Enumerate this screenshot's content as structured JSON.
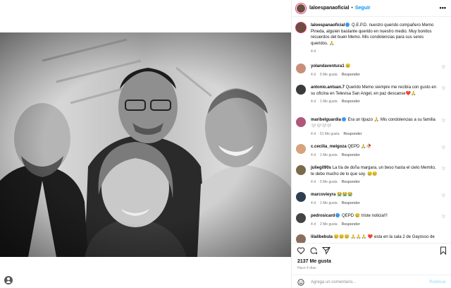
{
  "post": {
    "username": "laloespanaoficial",
    "follow_label": "Seguir",
    "more_label": "•••",
    "caption_user": "laloespanaoficial",
    "caption_text": "Q.E.P.D. nuestro querido compañero Memo Pineda, alguien bastante querido en nuestro medio. Muy bonitos recuerdos del buen Memo. Mis condolencias para sus seres queridos. 🙏",
    "caption_time": "4 d"
  },
  "comments": [
    {
      "user": "yolandaventura1",
      "text": "😢",
      "time": "4 d",
      "likes": "5 Me gusta",
      "reply": "Responder",
      "avatar_color": "#c98f7a"
    },
    {
      "user": "antonio.antuan.7",
      "text": "Querido Memo siempre me recibía con gusto en su oficina en Televisa San Angel, en paz descanse❤️🙏",
      "time": "4 d",
      "likes": "1 Me gusta",
      "reply": "Responder",
      "avatar_color": "#3b3b3b"
    },
    {
      "user": "maribelguardia",
      "text": "Era un tipazo 🙏 Mis condolencias a su familia 🤍🤍🤍🤍",
      "time": "4 d",
      "likes": "51 Me gusta",
      "reply": "Responder",
      "avatar_color": "#b0567a"
    },
    {
      "user": "c.cecilia_melgoza",
      "text": "QEPD 🙏🥀",
      "time": "4 d",
      "likes": "1 Me gusta",
      "reply": "Responder",
      "avatar_color": "#d7a27c"
    },
    {
      "user": "juliegil90s",
      "text": "La tía de doña margara, un beso hasta el cielo Memito, te debo mucho de lo que soy. 😢😢",
      "time": "4 d",
      "likes": "5 Me gusta",
      "reply": "Responder",
      "avatar_color": "#7a6a4a"
    },
    {
      "user": "marcovieyra",
      "text": "😭😭😭",
      "time": "4 d",
      "likes": "1 Me gusta",
      "reply": "Responder",
      "avatar_color": "#2e3e4f"
    },
    {
      "user": "pedrosicard",
      "text": "QEPD 😢 triste noticia!!!",
      "time": "4 d",
      "likes": "2 Me gusta",
      "reply": "Responder",
      "avatar_color": "#444444"
    },
    {
      "user": "lilalibebula",
      "text": "😢😢😢 🙏🙏🙏 ❤️ esta en la sala 2 de Gayosso de",
      "time": "",
      "likes": "",
      "reply": "",
      "avatar_color": "#8c6d5c"
    }
  ],
  "actions": {
    "likes_text": "2137 Me gusta",
    "time_text": "Hace 4 días",
    "comment_placeholder": "Agrega un comentario...",
    "publish_label": "Publicar"
  },
  "colors": {
    "accent": "#0095f6",
    "muted": "#737373",
    "avatar_ring": "#d93a7a"
  },
  "icons": [
    "heart-icon",
    "comment-icon",
    "share-icon",
    "bookmark-icon",
    "emoji-icon",
    "more-icon",
    "user-tag-icon"
  ]
}
